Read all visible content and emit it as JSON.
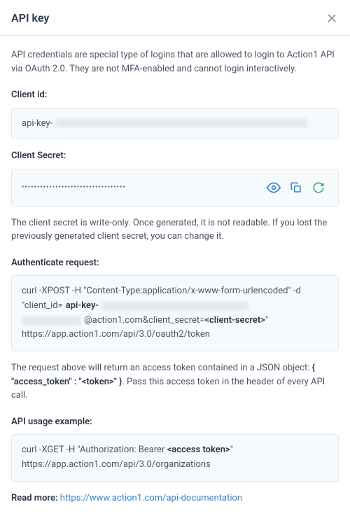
{
  "dialog": {
    "title": "API key"
  },
  "intro": "API credentials are special type of logins that are allowed to login to Action1 API via OAuth 2.0. They are not MFA-enabled and cannot login interactively.",
  "clientId": {
    "label": "Client id:",
    "prefix": "api-key-"
  },
  "clientSecret": {
    "label": "Client Secret:",
    "maskedValue": "••••••••••••••••••••••••••••••••••",
    "note": "The client secret is write-only. Once generated, it is not readable. If you lost the previously generated client secret, you can change it."
  },
  "authRequest": {
    "label": "Authenticate request:",
    "line1": "curl -XPOST -H \"Content-Type:application/x-www-form-urlencoded\" -d",
    "line2_prefix": "\"client_id=",
    "line2_bold": "api-key-",
    "line3_suffix_domain": "@action1.com",
    "line3_suffix_param": "&client_secret=",
    "line3_suffix_bold": "<client-secret>",
    "line3_suffix_close": "\"",
    "line4": "https://app.action1.com/api/3.0/oauth2/token"
  },
  "tokenNote": {
    "part1": "The request above will return an access token contained in a JSON object: ",
    "bold": "{ \"access_token\" : \"<token>\" }",
    "part2": ". Pass this access token in the header of every API call."
  },
  "usageExample": {
    "label": "API usage example:",
    "line1_prefix": "curl -XGET -H \"Authorization: Bearer ",
    "line1_bold": "<access token>",
    "line1_suffix": "\"",
    "line2": "https://app.action1.com/api/3.0/organizations"
  },
  "readMore": {
    "label": "Read more: ",
    "linkText": "https://www.action1.com/api-documentation"
  }
}
